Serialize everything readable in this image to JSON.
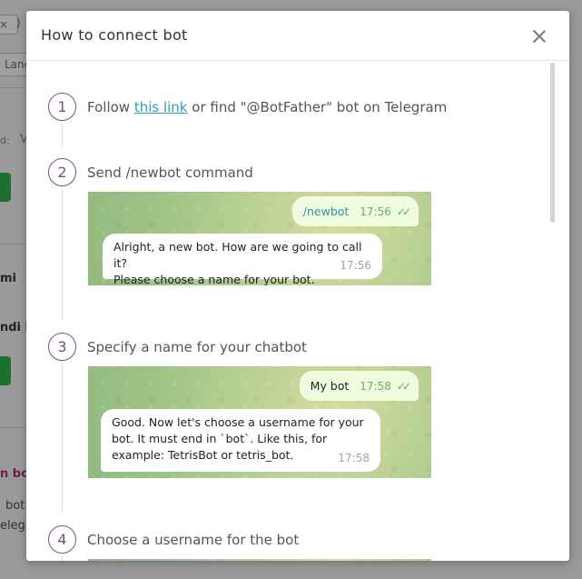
{
  "background": {
    "chip_text": "×",
    "paren": ")",
    "lang_text": "Lang",
    "field_label": "d:",
    "field_value": "V",
    "bold_1": "mi",
    "bold_2": "ndi l",
    "purple_text": "n bot",
    "text_1": "bot",
    "text_2": "elegr"
  },
  "modal": {
    "title": "How to connect bot",
    "steps": [
      {
        "number": "1",
        "text_before": "Follow ",
        "link": "this link",
        "text_after": " or find \"@BotFather\" bot on Telegram"
      },
      {
        "number": "2",
        "text": "Send /newbot command"
      },
      {
        "number": "3",
        "text": "Specify a name for your chatbot"
      },
      {
        "number": "4",
        "text": "Choose a username for the bot"
      }
    ],
    "chat_2": {
      "out_text": "/newbot",
      "out_time": "17:56",
      "in_line1": "Alright, a new bot. How are we going to call it?",
      "in_line2": "Please choose a name for your bot.",
      "in_time": "17:56"
    },
    "chat_3": {
      "out_text": "My bot",
      "out_time": "17:58",
      "in_line1": "Good. Now let's choose a username for your",
      "in_line2": "bot. It must end in `bot`. Like this, for",
      "in_line3": "example: TetrisBot or tetris_bot.",
      "in_time": "17:58"
    },
    "colors": {
      "accent": "#7b4f8b",
      "link": "#2a9fbd",
      "out_bubble": "#effdde",
      "check": "#5db158"
    }
  }
}
